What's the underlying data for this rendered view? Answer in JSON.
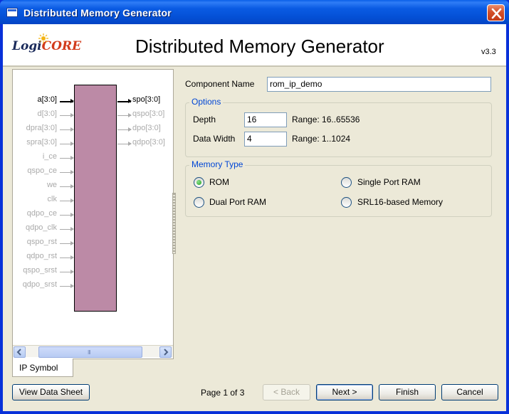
{
  "window": {
    "title": "Distributed Memory Generator"
  },
  "header": {
    "logo_text_a": "Logi",
    "logo_text_b": "CORE",
    "title": "Distributed Memory Generator",
    "version": "v3.3"
  },
  "symbol": {
    "left_pins": [
      "a[3:0]",
      "d[3:0]",
      "dpra[3:0]",
      "spra[3:0]",
      "i_ce",
      "qspo_ce",
      "we",
      "clk",
      "qdpo_ce",
      "qdpo_clk",
      "qspo_rst",
      "qdpo_rst",
      "qspo_srst",
      "qdpo_srst"
    ],
    "right_pins": [
      "spo[3:0]",
      "qspo[3:0]",
      "dpo[3:0]",
      "qdpo[3:0]"
    ],
    "scroll_grip": "III",
    "tab_label": "IP Symbol"
  },
  "form": {
    "component_name_label": "Component Name",
    "component_name_value": "rom_ip_demo",
    "options_title": "Options",
    "depth_label": "Depth",
    "depth_value": "16",
    "depth_range": "Range: 16..65536",
    "width_label": "Data Width",
    "width_value": "4",
    "width_range": "Range: 1..1024",
    "memory_type_title": "Memory Type",
    "memory_types": [
      "ROM",
      "Single Port RAM",
      "Dual Port RAM",
      "SRL16-based Memory"
    ],
    "selected_memory_type": "ROM"
  },
  "footer": {
    "datasheet_label": "View Data Sheet",
    "page_info": "Page 1 of 3",
    "back_label": "< Back",
    "next_label": "Next >",
    "finish_label": "Finish",
    "cancel_label": "Cancel"
  },
  "colors": {
    "title_bar": "#0a5be3",
    "block_fill": "#bc8aa6",
    "group_title": "#0046d5",
    "close_button": "#d3502a"
  },
  "icons": [
    "window-app-icon",
    "close-icon",
    "logicore-sun-icon",
    "scroll-left-icon",
    "scroll-right-icon"
  ]
}
